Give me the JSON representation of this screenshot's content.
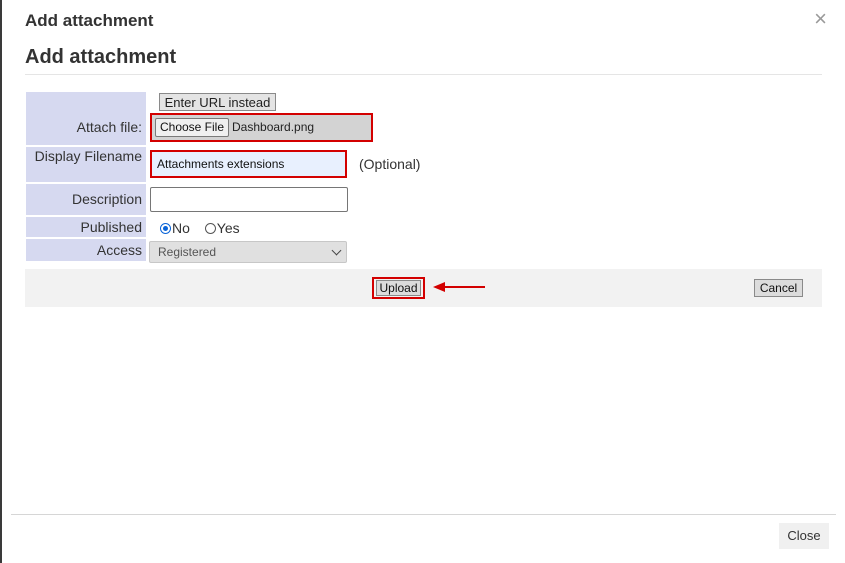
{
  "modal": {
    "title": "Add attachment",
    "close_icon": "close-icon",
    "close_glyph": "×"
  },
  "page": {
    "heading": "Add attachment"
  },
  "form": {
    "enter_url_label": "Enter URL instead",
    "attach_file_label": "Attach file:",
    "choose_file_label": "Choose File",
    "file_name": "Dashboard.png",
    "display_filename_label": "Display Filename",
    "display_filename_value": "Attachments extensions",
    "optional_text": "(Optional)",
    "description_label": "Description",
    "description_value": "",
    "published_label": "Published",
    "published_options": [
      "No",
      "Yes"
    ],
    "published_selected": "No",
    "access_label": "Access",
    "access_value": "Registered"
  },
  "actions": {
    "upload_label": "Upload",
    "cancel_label": "Cancel"
  },
  "footer": {
    "close_label": "Close"
  },
  "colors": {
    "label_bg": "#d6d9f0",
    "highlight": "#d30000",
    "radio_accent": "#0a64d8"
  }
}
